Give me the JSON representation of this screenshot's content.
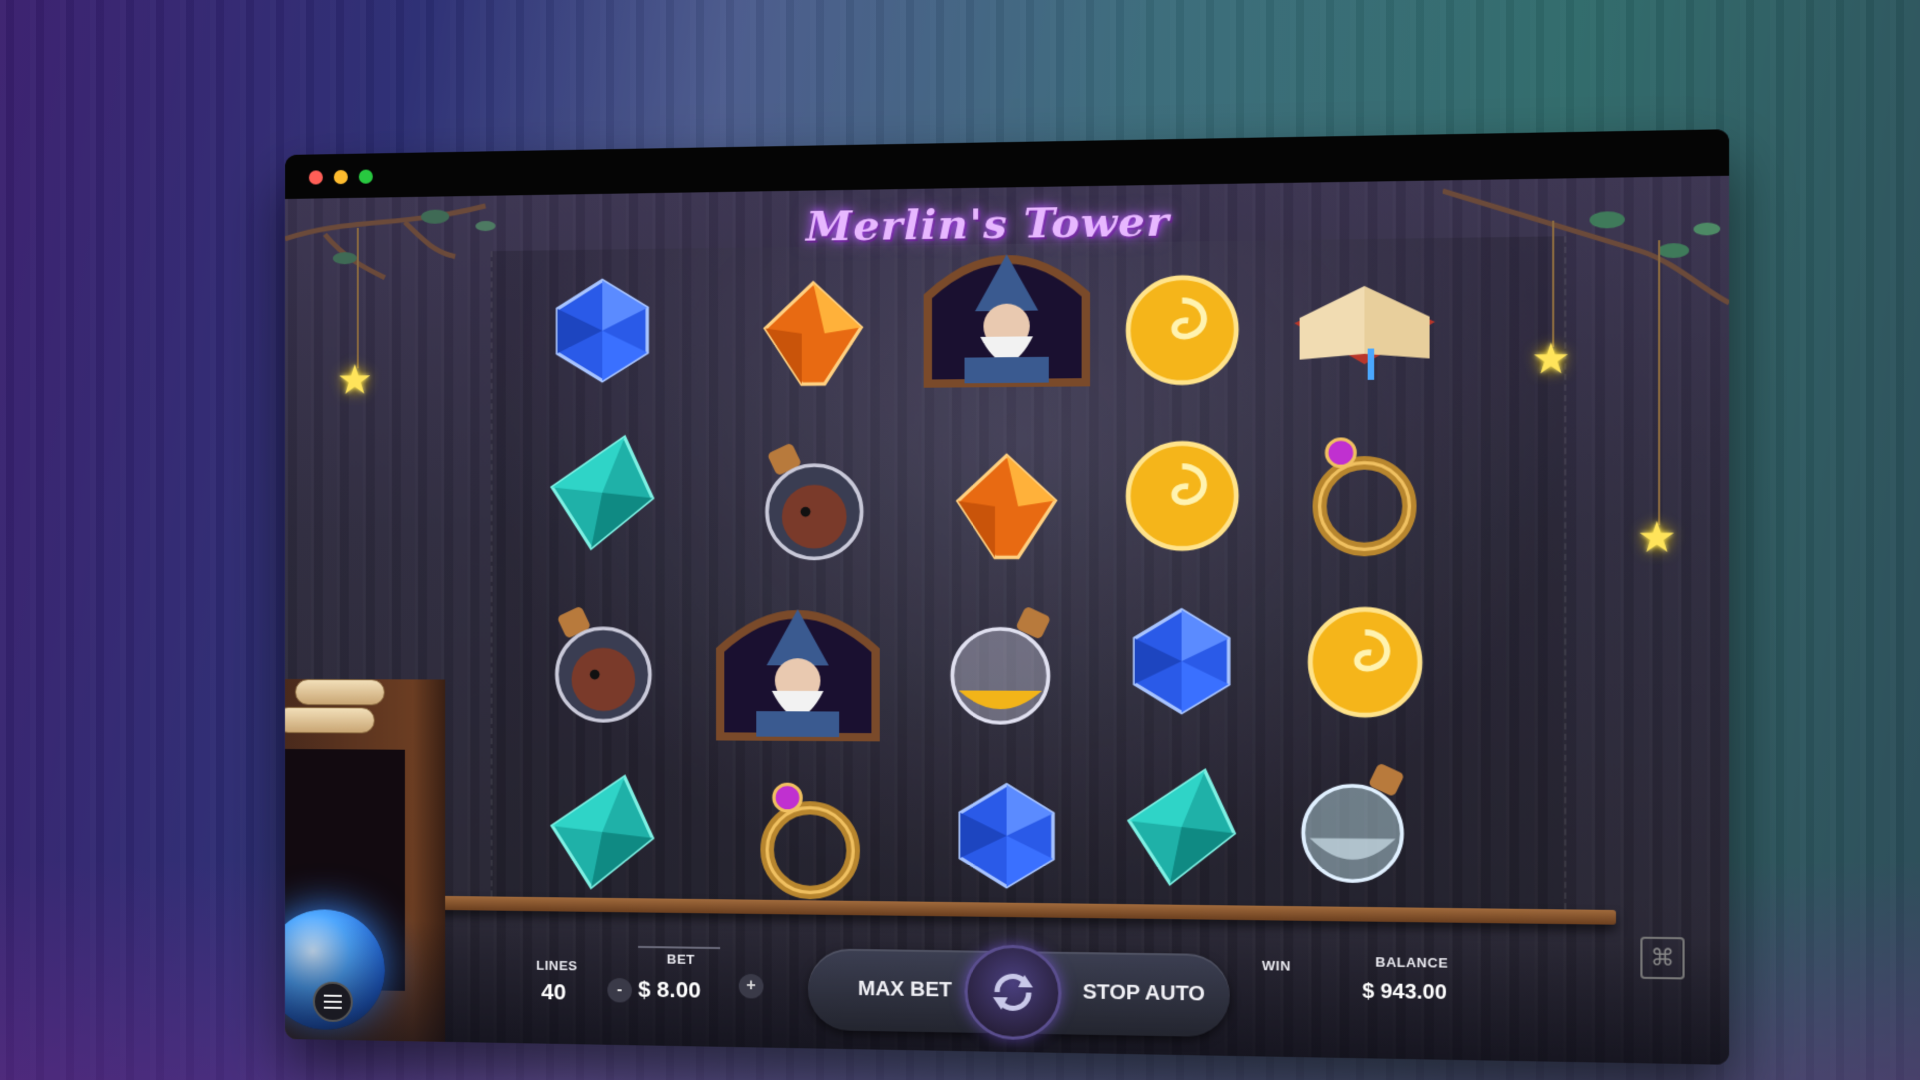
{
  "window": {
    "traffic_lights": [
      "close",
      "minimize",
      "maximize"
    ]
  },
  "game": {
    "title": "Merlin's Tower"
  },
  "reels": [
    [
      "blue-gem",
      "teal-gem",
      "octopus-potion",
      "teal-gem"
    ],
    [
      "orange-gem",
      "octopus-potion",
      "merlin-portrait",
      "gold-ring"
    ],
    [
      "merlin-portrait",
      "orange-gem",
      "gold-potion",
      "blue-gem"
    ],
    [
      "gold-coin",
      "gold-coin",
      "blue-gem",
      "teal-gem"
    ],
    [
      "spell-book",
      "gold-ring",
      "gold-coin",
      "clear-potion"
    ]
  ],
  "controls": {
    "lines_label": "LINES",
    "lines_value": "40",
    "bet_label": "BET",
    "bet_value": "$ 8.00",
    "minus_label": "-",
    "plus_label": "+",
    "max_bet_label": "MAX BET",
    "stop_auto_label": "STOP AUTO",
    "win_label": "WIN",
    "win_value": "",
    "balance_label": "BALANCE",
    "balance_value": "$ 943.00"
  },
  "colors": {
    "accent_title": "#e7b7ff",
    "star": "#ffe45a"
  }
}
